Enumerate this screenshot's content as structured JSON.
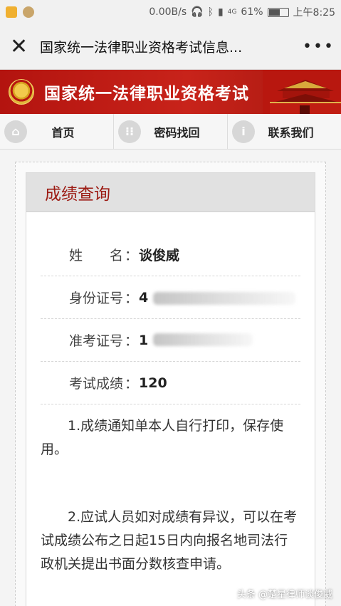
{
  "status_bar": {
    "net_speed": "0.00B/s",
    "battery": "61%",
    "battery_level": 0.61,
    "time": "上午8:25",
    "signal_label": "4G"
  },
  "title_bar": {
    "title": "国家统一法律职业资格考试信息..."
  },
  "banner": {
    "title": "国家统一法律职业资格考试"
  },
  "nav": {
    "items": [
      {
        "label": "首页",
        "icon": "home-icon"
      },
      {
        "label": "密码找回",
        "icon": "grid-icon"
      },
      {
        "label": "联系我们",
        "icon": "info-icon"
      }
    ]
  },
  "result": {
    "heading": "成绩查询",
    "fields": [
      {
        "label": "姓　　名",
        "value": "谈俊威"
      },
      {
        "label": "身份证号",
        "value": "4"
      },
      {
        "label": "准考证号",
        "value": "1"
      },
      {
        "label": "考试成绩",
        "value": "120"
      }
    ],
    "notes": [
      "1.成绩通知单本人自行打印，保存使用。",
      "2.应试人员如对成绩有异议，可以在考试成绩公布之日起15日内向报名地司法行政机关提出书面分数核查申请。"
    ]
  },
  "watermark": "头条 @楚星律师谈俊威",
  "colors": {
    "banner_red": "#c8231a",
    "heading_red": "#9c1b13"
  }
}
